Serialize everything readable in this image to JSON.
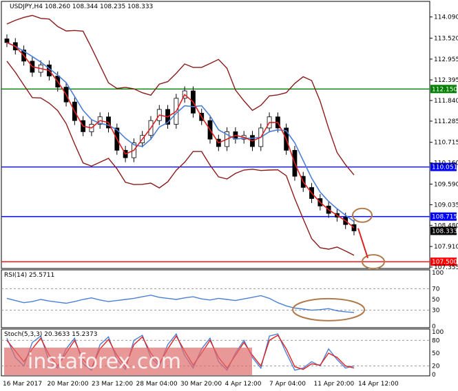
{
  "chart_data": [
    {
      "type": "candlestick",
      "title": "USDJPY,H4  108.260 108.344 108.235 108.333",
      "ylim": [
        107.355,
        114.25
      ],
      "y_ticks": [
        "114.090",
        "113.520",
        "112.955",
        "112.395",
        "111.840",
        "111.285",
        "110.715",
        "110.160",
        "109.590",
        "109.035",
        "108.480",
        "107.910",
        "107.355"
      ],
      "x_ticks": [
        "16 Mar 2017",
        "20 Mar 20:00",
        "23 Mar 12:00",
        "28 Mar 04:00",
        "30 Mar 20:00",
        "4 Apr 12:00",
        "7 Apr 04:00",
        "11 Apr 20:00",
        "14 Apr 12:00"
      ],
      "horizontal_levels": [
        {
          "label": "112.150",
          "value": 112.15,
          "color": "#008000"
        },
        {
          "label": "110.051",
          "value": 110.051,
          "color": "#0000ff"
        },
        {
          "label": "108.715",
          "value": 108.715,
          "color": "#0000ff"
        },
        {
          "label": "107.500",
          "value": 107.5,
          "color": "#ff0000"
        }
      ],
      "current_price": "108.333",
      "close_path": [
        113.4,
        113.2,
        112.9,
        112.6,
        112.8,
        112.5,
        112.2,
        111.8,
        111.3,
        111.0,
        111.2,
        111.4,
        111.1,
        110.5,
        110.3,
        110.7,
        110.9,
        111.3,
        111.6,
        111.2,
        111.9,
        112.1,
        111.5,
        111.3,
        110.8,
        110.6,
        111.0,
        110.8,
        110.9,
        110.6,
        111.1,
        111.4,
        111.1,
        110.5,
        109.8,
        109.5,
        109.2,
        109.0,
        108.8,
        108.7,
        108.5,
        108.33
      ],
      "indicators": [
        "Moving Average (red)",
        "Moving Average (blue)",
        "Bollinger Bands (brown)"
      ]
    },
    {
      "type": "line",
      "title": "RSI(14) 25.5711",
      "ylim": [
        0,
        100
      ],
      "y_ticks": [
        "100",
        "70",
        "50",
        "30",
        "0"
      ],
      "rsi_path": [
        52,
        48,
        44,
        46,
        50,
        47,
        45,
        43,
        46,
        50,
        53,
        49,
        46,
        48,
        50,
        52,
        55,
        58,
        54,
        52,
        50,
        53,
        55,
        51,
        49,
        52,
        50,
        48,
        51,
        54,
        57,
        52,
        44,
        38,
        34,
        32,
        30,
        31,
        33,
        29,
        27,
        25.6
      ]
    },
    {
      "type": "line",
      "title": "Stoch(5,3,3) 20.3633 15.2373",
      "ylim": [
        0,
        100
      ],
      "y_ticks": [
        "100",
        "80",
        "50",
        "20",
        "0"
      ],
      "main_path": [
        85,
        40,
        20,
        75,
        90,
        30,
        15,
        60,
        85,
        25,
        10,
        70,
        88,
        35,
        12,
        80,
        92,
        40,
        20,
        70,
        95,
        45,
        15,
        60,
        85,
        30,
        10,
        50,
        80,
        40,
        15,
        90,
        95,
        50,
        10,
        15,
        30,
        20,
        60,
        35,
        15,
        20.36
      ],
      "signal_path": [
        80,
        55,
        30,
        60,
        85,
        45,
        20,
        50,
        80,
        35,
        15,
        60,
        82,
        45,
        18,
        70,
        88,
        50,
        25,
        60,
        90,
        55,
        22,
        50,
        80,
        40,
        15,
        45,
        75,
        45,
        20,
        80,
        92,
        60,
        18,
        12,
        25,
        22,
        50,
        40,
        20,
        15.24
      ]
    }
  ],
  "watermark": "instaforex.com"
}
